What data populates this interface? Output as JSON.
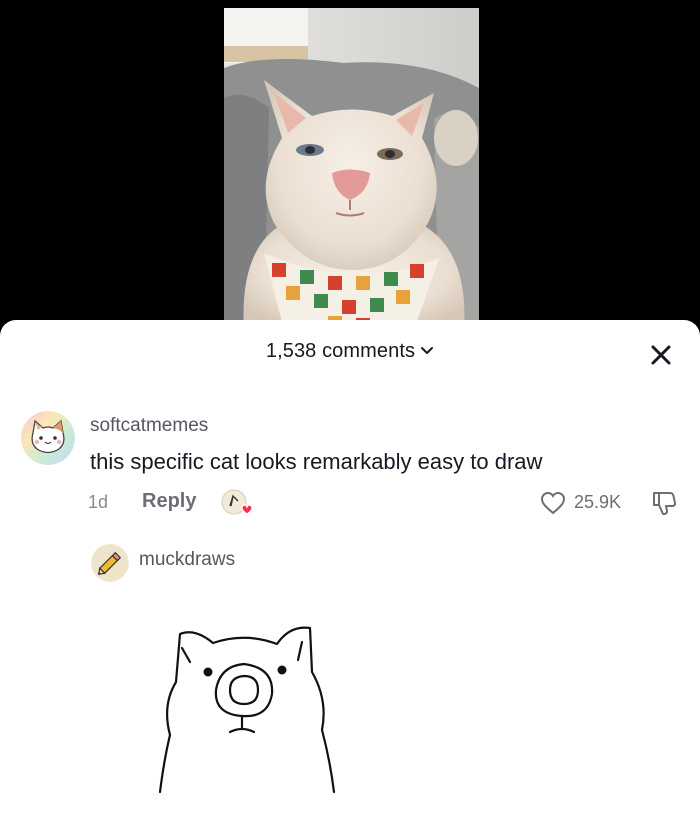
{
  "video": {
    "content": "cat photo"
  },
  "comments_sheet": {
    "count_label": "1,538 comments",
    "close_icon": "close-icon"
  },
  "comments": [
    {
      "username": "softcatmemes",
      "text": "this specific cat looks remarkably easy to draw",
      "time": "1d",
      "reply_label": "Reply",
      "like_count": "25.9K",
      "icons": [
        "like-icon",
        "dislike-icon",
        "liked-by-creator-icon"
      ]
    },
    {
      "username": "muckdraws",
      "avatar_icon": "pencil-icon",
      "content": "cat drawing"
    }
  ],
  "colors": {
    "text_primary": "#161823",
    "text_secondary": "#545762",
    "sheet_bg": "#ffffff",
    "video_bg": "#000000",
    "heart_badge": "#fe2c55"
  }
}
